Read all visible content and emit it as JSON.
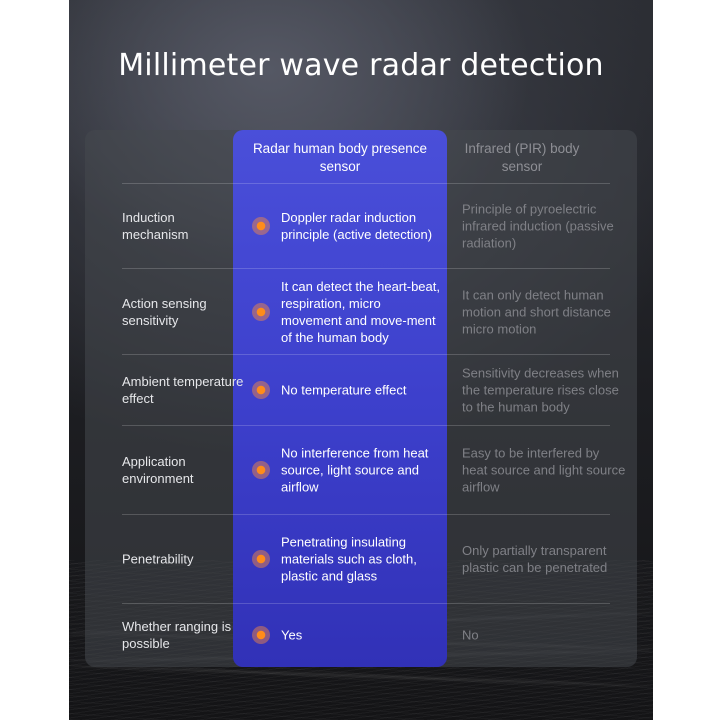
{
  "title": "Millimeter wave radar detection",
  "columns": {
    "radar": "Radar human body presence sensor",
    "pir": "Infrared (PIR) body sensor"
  },
  "colors": {
    "accent_blue": "#4a4fd9",
    "bullet_orange": "#ff8c1a",
    "background_dark": "#1d1e22"
  },
  "bullet_icon": "orange-dot-icon",
  "rows": [
    {
      "label": "Induction mechanism",
      "radar": "Doppler radar induction principle (active detection)",
      "pir": "Principle of pyroelectric infrared induction (passive radiation)"
    },
    {
      "label": "Action sensing sensitivity",
      "radar": "It can detect the heart-beat, respiration, micro movement and move-ment of the human body",
      "pir": "It can only detect human motion and short distance micro motion"
    },
    {
      "label": "Ambient temperature effect",
      "radar": "No temperature effect",
      "pir": "Sensitivity decreases when the temperature rises close to the human body"
    },
    {
      "label": "Application environment",
      "radar": "No interference from heat source, light source and airflow",
      "pir": "Easy to be interfered by heat source and light source airflow"
    },
    {
      "label": "Penetrability",
      "radar": "Penetrating insulating materials such as cloth, plastic and glass",
      "pir": "Only partially transparent plastic can be penetrated"
    },
    {
      "label": "Whether ranging is possible",
      "radar": "Yes",
      "pir": "No"
    }
  ]
}
